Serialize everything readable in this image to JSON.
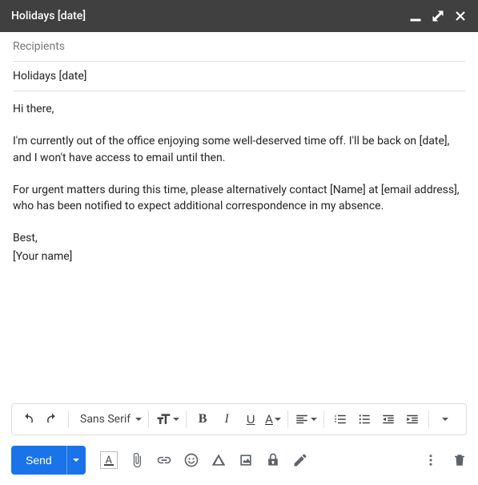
{
  "window": {
    "title": "Holidays [date]"
  },
  "fields": {
    "recipients_placeholder": "Recipients",
    "subject": "Holidays [date]"
  },
  "body": {
    "greeting": "Hi there,",
    "p1": "I'm currently out of the office enjoying some well-deserved time off. I'll be back on [date], and I won't have access to email until then.",
    "p2": "For urgent matters during this time, please alternatively contact [Name] at [email address], who has been notified to expect additional correspondence in my absence.",
    "signoff": "Best,",
    "name": "[Your name]"
  },
  "toolbar": {
    "font": "Sans Serif"
  },
  "actions": {
    "send_label": "Send"
  }
}
